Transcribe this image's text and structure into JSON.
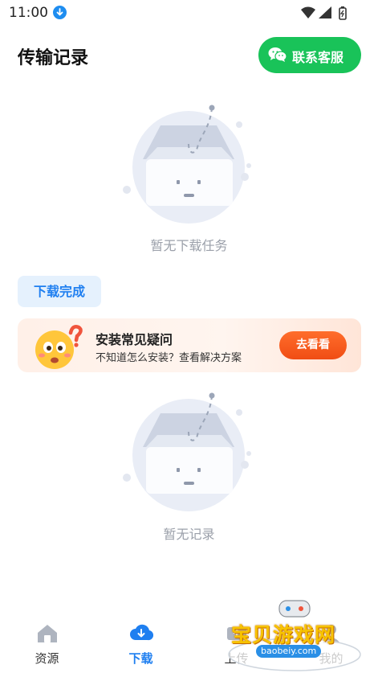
{
  "status_bar": {
    "time": "11:00"
  },
  "header": {
    "title": "传输记录",
    "service_button": "联系客服"
  },
  "download_section": {
    "empty_text": "暂无下载任务"
  },
  "completed_section": {
    "tag": "下载完成",
    "empty_text": "暂无记录"
  },
  "faq_banner": {
    "title": "安装常见疑问",
    "subtitle": "不知道怎么安装？查看解决方案",
    "button": "去看看"
  },
  "bottom_nav": {
    "items": [
      {
        "label": "资源",
        "active": false
      },
      {
        "label": "下载",
        "active": true
      },
      {
        "label": "上传",
        "active": false
      },
      {
        "label": "我的",
        "active": false
      }
    ]
  },
  "watermark": {
    "text": "宝贝游戏网",
    "url": "baobeiy.com"
  },
  "colors": {
    "accent": "#1f7ff0",
    "service_green": "#19c359",
    "cta_orange": "#f55a1c"
  }
}
